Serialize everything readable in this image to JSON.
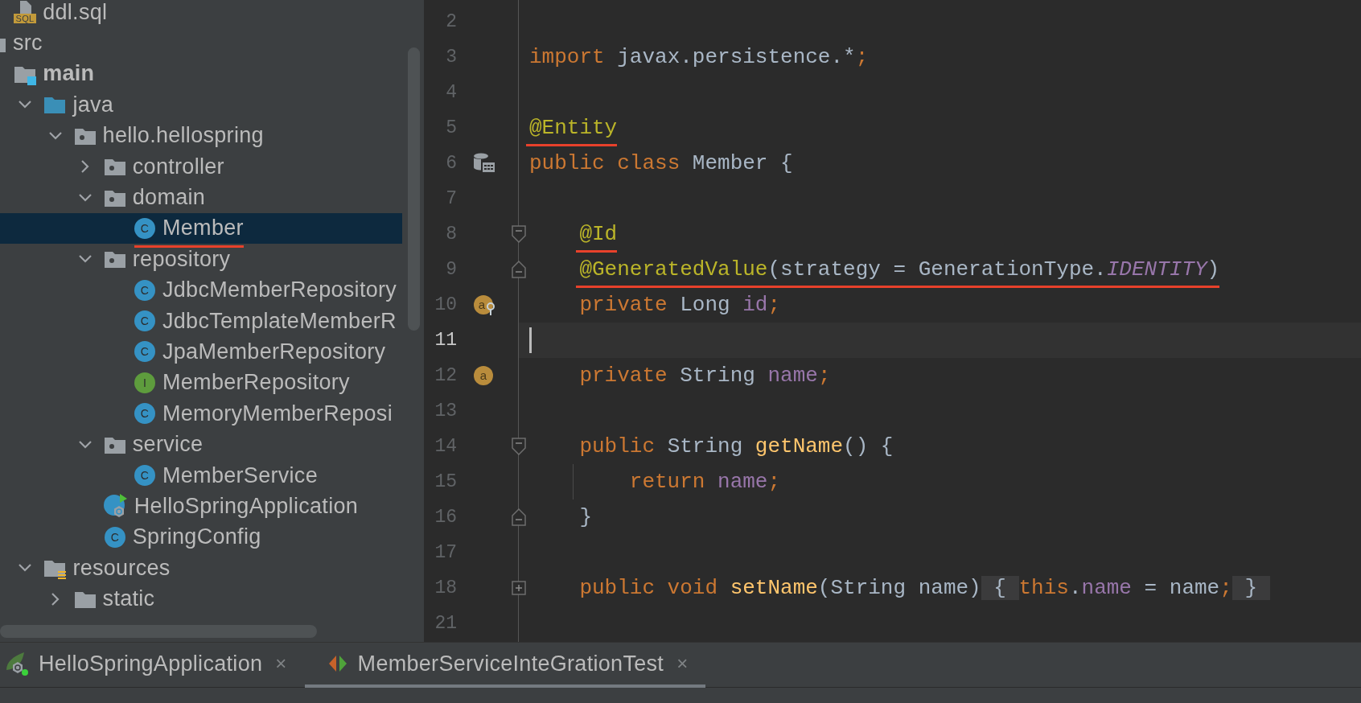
{
  "project_tree": [
    {
      "kind": "offscreen-folder",
      "children": [
        {
          "label": "ddl.sql",
          "kind": "sql-file",
          "icon_letter": "SQL",
          "selected": false,
          "underlined": false
        }
      ]
    },
    {
      "label": "src",
      "kind": "folder",
      "selected": false,
      "underlined": false,
      "children": [
        {
          "label": "main",
          "kind": "source-root",
          "selected": false,
          "underlined": false,
          "children": [
            {
              "label": "java",
              "kind": "source-folder",
              "expanded": true,
              "selected": false,
              "underlined": false,
              "children": [
                {
                  "label": "hello.hellospring",
                  "kind": "package",
                  "expanded": true,
                  "selected": false,
                  "underlined": false,
                  "children": [
                    {
                      "label": "controller",
                      "kind": "package",
                      "expanded": false,
                      "selected": false,
                      "underlined": false
                    },
                    {
                      "label": "domain",
                      "kind": "package",
                      "expanded": true,
                      "selected": false,
                      "underlined": false,
                      "children": [
                        {
                          "label": "Member",
                          "kind": "class",
                          "icon_letter": "C",
                          "selected": true,
                          "underlined": true
                        }
                      ]
                    },
                    {
                      "label": "repository",
                      "kind": "package",
                      "expanded": true,
                      "selected": false,
                      "underlined": false,
                      "children": [
                        {
                          "label": "JdbcMemberRepository",
                          "kind": "class",
                          "icon_letter": "C",
                          "selected": false,
                          "underlined": false
                        },
                        {
                          "label": "JdbcTemplateMemberR",
                          "kind": "class",
                          "icon_letter": "C",
                          "selected": false,
                          "underlined": false
                        },
                        {
                          "label": "JpaMemberRepository",
                          "kind": "class",
                          "icon_letter": "C",
                          "selected": false,
                          "underlined": false
                        },
                        {
                          "label": "MemberRepository",
                          "kind": "interface",
                          "icon_letter": "I",
                          "selected": false,
                          "underlined": false
                        },
                        {
                          "label": "MemoryMemberReposi",
                          "kind": "class",
                          "icon_letter": "C",
                          "selected": false,
                          "underlined": false
                        }
                      ]
                    },
                    {
                      "label": "service",
                      "kind": "package",
                      "expanded": true,
                      "selected": false,
                      "underlined": false,
                      "children": [
                        {
                          "label": "MemberService",
                          "kind": "class",
                          "icon_letter": "C",
                          "selected": false,
                          "underlined": false
                        }
                      ]
                    },
                    {
                      "label": "HelloSpringApplication",
                      "kind": "spring-app",
                      "selected": false,
                      "underlined": false
                    },
                    {
                      "label": "SpringConfig",
                      "kind": "class",
                      "icon_letter": "C",
                      "selected": false,
                      "underlined": false
                    }
                  ]
                }
              ]
            },
            {
              "label": "resources",
              "kind": "resources-folder",
              "expanded": true,
              "selected": false,
              "underlined": false,
              "children": [
                {
                  "label": "static",
                  "kind": "folder",
                  "expanded": false,
                  "selected": false,
                  "underlined": false
                }
              ]
            }
          ]
        }
      ]
    }
  ],
  "editor": {
    "lines": [
      {
        "number": "2",
        "current": false
      },
      {
        "number": "3",
        "current": false,
        "underlined": false,
        "tokens": [
          {
            "text": "import ",
            "kind": "keyword"
          },
          {
            "text": "javax.persistence.*",
            "kind": "plain"
          },
          {
            "text": ";",
            "kind": "keyword"
          }
        ]
      },
      {
        "number": "4",
        "current": false
      },
      {
        "number": "5",
        "current": false,
        "underlined": true,
        "tokens": [
          {
            "text": "@Entity",
            "kind": "annotation"
          }
        ]
      },
      {
        "number": "6",
        "current": false,
        "underlined": false,
        "gutter": {
          "kind": "entity"
        },
        "tokens": [
          {
            "text": "public class ",
            "kind": "keyword"
          },
          {
            "text": "Member {",
            "kind": "plain"
          }
        ]
      },
      {
        "number": "7",
        "current": false
      },
      {
        "number": "8",
        "current": false,
        "underlined": true,
        "fold": {
          "kind": "start"
        },
        "tokens": [
          {
            "text": "    @Id",
            "kind": "annotation"
          }
        ]
      },
      {
        "number": "9",
        "current": false,
        "underlined": true,
        "fold": {
          "kind": "end"
        },
        "tokens": [
          {
            "text": "    @GeneratedValue",
            "kind": "annotation"
          },
          {
            "text": "(strategy = GenerationType.",
            "kind": "plain"
          },
          {
            "text": "IDENTITY",
            "kind": "constant"
          },
          {
            "text": ")",
            "kind": "plain"
          }
        ]
      },
      {
        "number": "10",
        "current": false,
        "underlined": false,
        "gutter": {
          "kind": "id-field",
          "glyph": "a"
        },
        "tokens": [
          {
            "text": "    private ",
            "kind": "keyword"
          },
          {
            "text": "Long ",
            "kind": "plain"
          },
          {
            "text": "id",
            "kind": "field"
          },
          {
            "text": ";",
            "kind": "keyword"
          }
        ]
      },
      {
        "number": "11",
        "current": true
      },
      {
        "number": "12",
        "current": false,
        "underlined": false,
        "gutter": {
          "kind": "field",
          "glyph": "a"
        },
        "tokens": [
          {
            "text": "    private ",
            "kind": "keyword"
          },
          {
            "text": "String ",
            "kind": "plain"
          },
          {
            "text": "name",
            "kind": "field"
          },
          {
            "text": ";",
            "kind": "keyword"
          }
        ]
      },
      {
        "number": "13",
        "current": false
      },
      {
        "number": "14",
        "current": false,
        "underlined": false,
        "fold": {
          "kind": "start"
        },
        "tokens": [
          {
            "text": "    public ",
            "kind": "keyword"
          },
          {
            "text": "String ",
            "kind": "plain"
          },
          {
            "text": "getName",
            "kind": "method"
          },
          {
            "text": "() {",
            "kind": "plain"
          }
        ]
      },
      {
        "number": "15",
        "current": false,
        "underlined": false,
        "guide": true,
        "tokens": [
          {
            "text": "        return ",
            "kind": "keyword"
          },
          {
            "text": "name",
            "kind": "field"
          },
          {
            "text": ";",
            "kind": "keyword"
          }
        ]
      },
      {
        "number": "16",
        "current": false,
        "underlined": false,
        "fold": {
          "kind": "end"
        },
        "tokens": [
          {
            "text": "    }",
            "kind": "plain"
          }
        ]
      },
      {
        "number": "17",
        "current": false
      },
      {
        "number": "18",
        "current": false,
        "underlined": false,
        "fold": {
          "kind": "collapsed"
        },
        "tokens": [
          {
            "text": "    public void ",
            "kind": "keyword"
          },
          {
            "text": "setName",
            "kind": "method"
          },
          {
            "text": "(String name)",
            "kind": "plain"
          },
          {
            "text": " { ",
            "kind": "folded"
          },
          {
            "text": "this",
            "kind": "keyword"
          },
          {
            "text": ".",
            "kind": "plain"
          },
          {
            "text": "name",
            "kind": "field"
          },
          {
            "text": " = name",
            "kind": "plain"
          },
          {
            "text": ";",
            "kind": "keyword"
          },
          {
            "text": " } ",
            "kind": "folded"
          }
        ]
      },
      {
        "number": "21",
        "current": false
      }
    ]
  },
  "bottom_tabs": [
    {
      "label": "HelloSpringApplication",
      "kind": "spring-run",
      "selected": false,
      "close": "×"
    },
    {
      "label": "MemberServiceInteGrationTest",
      "kind": "test",
      "selected": true,
      "close": "×"
    }
  ]
}
